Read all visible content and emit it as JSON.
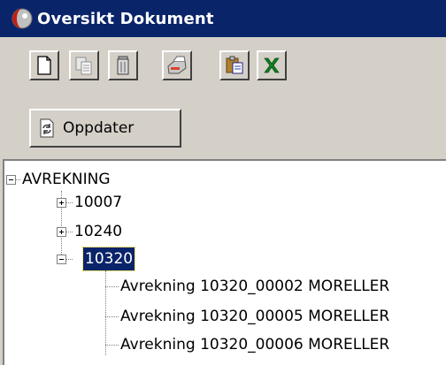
{
  "window": {
    "title": "Oversikt Dokument",
    "icon": "app-icon"
  },
  "toolbar": {
    "buttons": [
      {
        "name": "new-document-icon"
      },
      {
        "name": "copy-document-icon"
      },
      {
        "name": "delete-icon"
      },
      {
        "name": "print-icon"
      },
      {
        "name": "paste-icon"
      },
      {
        "name": "excel-icon"
      }
    ]
  },
  "refresh_button": {
    "label": "Oppdater",
    "icon": "refresh-icon"
  },
  "tree": {
    "root": "AVREKNING",
    "items": [
      {
        "label": "10007",
        "expanded": false
      },
      {
        "label": "10240",
        "expanded": false
      },
      {
        "label": "10320",
        "expanded": true,
        "selected": true
      }
    ],
    "children": [
      "Avrekning 10320_00002 MORELLER",
      "Avrekning 10320_00005 MORELLER",
      "Avrekning 10320_00006 MORELLER"
    ]
  },
  "colors": {
    "titlebar": "#0a246a",
    "selection": "#0a246a",
    "face": "#d4d0c8"
  }
}
